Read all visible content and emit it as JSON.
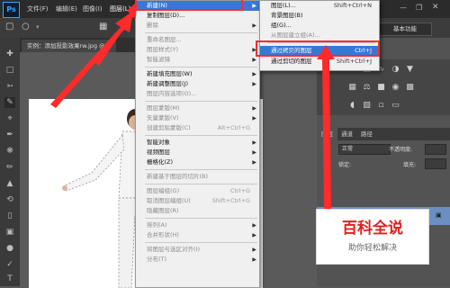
{
  "app_logo": "Ps",
  "menubar": {
    "items": [
      "文件(F)",
      "编辑(E)",
      "图像(I)",
      "图层(L)"
    ]
  },
  "options_bar": {
    "workspace_button": "基本功能"
  },
  "document_tab": {
    "title": "实例：添加投影效果rw.jpg @ 6"
  },
  "context_menu": {
    "items": [
      {
        "label": "新建(N)",
        "shortcut": "",
        "submenu": true,
        "state": "highlighted"
      },
      {
        "label": "复制图层(D)...",
        "shortcut": "",
        "submenu": false,
        "state": "normal"
      },
      {
        "label": "删除",
        "shortcut": "",
        "submenu": true,
        "state": "disabled"
      },
      {
        "label": "重命名图层...",
        "shortcut": "",
        "submenu": false,
        "state": "disabled"
      },
      {
        "label": "图层样式(Y)",
        "shortcut": "",
        "submenu": true,
        "state": "disabled"
      },
      {
        "label": "智能滤镜",
        "shortcut": "",
        "submenu": true,
        "state": "disabled"
      },
      {
        "label": "新建填充图层(W)",
        "shortcut": "",
        "submenu": true,
        "state": "normal"
      },
      {
        "label": "新建调整图层(J)",
        "shortcut": "",
        "submenu": true,
        "state": "normal"
      },
      {
        "label": "图层内容选项(O)...",
        "shortcut": "",
        "submenu": false,
        "state": "disabled"
      },
      {
        "label": "图层蒙版(M)",
        "shortcut": "",
        "submenu": true,
        "state": "disabled"
      },
      {
        "label": "矢量蒙版(V)",
        "shortcut": "",
        "submenu": true,
        "state": "disabled"
      },
      {
        "label": "创建剪贴蒙版(C)",
        "shortcut": "Alt+Ctrl+G",
        "submenu": false,
        "state": "disabled"
      },
      {
        "label": "智能对象",
        "shortcut": "",
        "submenu": true,
        "state": "normal"
      },
      {
        "label": "视频图层",
        "shortcut": "",
        "submenu": true,
        "state": "normal"
      },
      {
        "label": "栅格化(Z)",
        "shortcut": "",
        "submenu": true,
        "state": "normal"
      },
      {
        "label": "新建基于图层的切片(B)",
        "shortcut": "",
        "submenu": false,
        "state": "disabled"
      },
      {
        "label": "图层编组(G)",
        "shortcut": "Ctrl+G",
        "submenu": false,
        "state": "disabled"
      },
      {
        "label": "取消图层编组(U)",
        "shortcut": "Shift+Ctrl+G",
        "submenu": false,
        "state": "disabled"
      },
      {
        "label": "隐藏图层(R)",
        "shortcut": "",
        "submenu": false,
        "state": "disabled"
      },
      {
        "label": "排列(A)",
        "shortcut": "",
        "submenu": true,
        "state": "disabled"
      },
      {
        "label": "合并形状(H)",
        "shortcut": "",
        "submenu": true,
        "state": "disabled"
      },
      {
        "label": "将图层与选区对齐(I)",
        "shortcut": "",
        "submenu": true,
        "state": "disabled"
      },
      {
        "label": "分布(T)",
        "shortcut": "",
        "submenu": true,
        "state": "disabled"
      }
    ]
  },
  "submenu": {
    "items": [
      {
        "label": "图层(L)...",
        "shortcut": "Shift+Ctrl+N",
        "state": "normal"
      },
      {
        "label": "背景图层(B)",
        "shortcut": "",
        "state": "normal"
      },
      {
        "label": "组(G)...",
        "shortcut": "",
        "state": "normal"
      },
      {
        "label": "从图层建立组(A)...",
        "shortcut": "",
        "state": "disabled"
      },
      {
        "label": "通过拷贝的图层",
        "shortcut": "Ctrl+J",
        "state": "highlighted"
      },
      {
        "label": "通过剪切的图层",
        "shortcut": "Shift+Ctrl+J",
        "state": "normal"
      }
    ]
  },
  "layers_panel": {
    "tabs": [
      "图层",
      "通道",
      "路径"
    ],
    "blend_mode": "正常",
    "opacity_label": "不透明度:",
    "lock_label": "锁定:",
    "fill_label": "填充:",
    "layer_name": "背景"
  },
  "watermark": {
    "title": "百科全说",
    "subtitle": "助你轻松解决"
  },
  "colors": {
    "highlight": "#3877d6",
    "annotation_arrow": "#ff2a2a",
    "watermark_red": "#e02020"
  }
}
